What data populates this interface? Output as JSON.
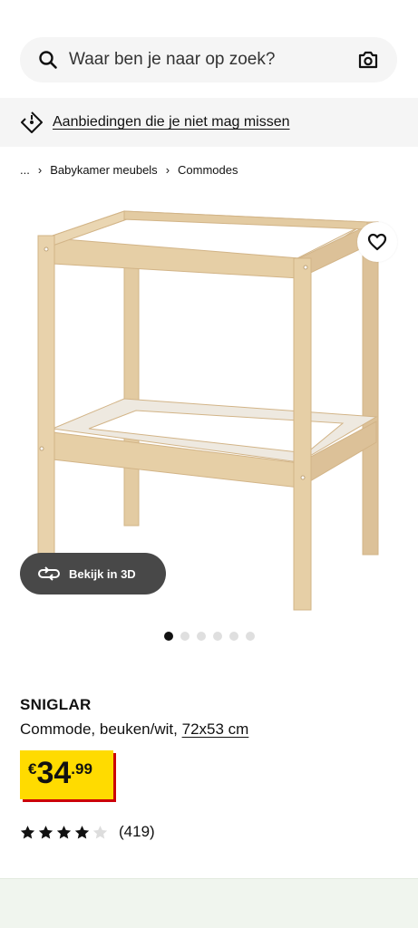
{
  "search": {
    "placeholder": "Waar ben je naar op zoek?"
  },
  "promo": {
    "text": "Aanbiedingen die je niet mag missen"
  },
  "breadcrumb": {
    "items": [
      "...",
      "Babykamer meubels",
      "Commodes"
    ]
  },
  "gallery": {
    "view3d_label": "Bekijk in 3D",
    "image_count": 6,
    "active_index": 0
  },
  "product": {
    "name": "SNIGLAR",
    "description": "Commode, beuken/wit,",
    "dimensions": "72x53 cm",
    "price": {
      "currency": "€",
      "integer": "34",
      "decimal": ".99"
    },
    "rating": {
      "value": 4,
      "max": 5,
      "count": "(419)"
    }
  },
  "colors": {
    "price_bg": "#ffdb00",
    "price_shadow": "#cc0008",
    "button_dark": "#484848",
    "surface_grey": "#f5f5f5"
  },
  "icons": [
    "search-icon",
    "camera-icon",
    "tag-icon",
    "chevron-right-icon",
    "heart-icon",
    "rotate-3d-icon",
    "star-icon"
  ]
}
